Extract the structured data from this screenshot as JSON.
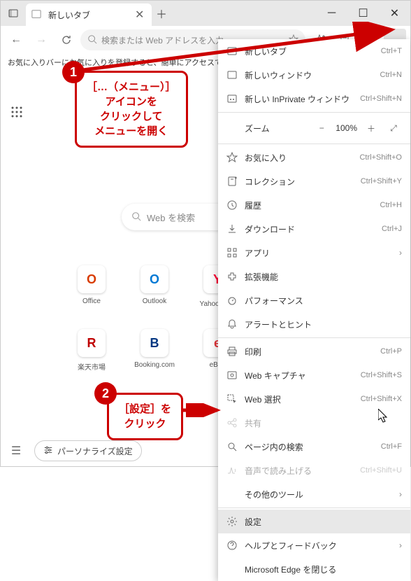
{
  "tab": {
    "title": "新しいタブ"
  },
  "addressbar": {
    "placeholder": "検索または Web アドレスを入力"
  },
  "infobar": {
    "text": "お気に入りバーにお気に入りを登録すると、簡単にアクセスできるようになります。"
  },
  "search": {
    "placeholder": "Web を検索"
  },
  "tiles": [
    {
      "label": "Office",
      "letter": "O",
      "color": "#d83b01"
    },
    {
      "label": "Outlook",
      "letter": "O",
      "color": "#0078d4"
    },
    {
      "label": "Yahoo!メ…",
      "letter": "Y",
      "color": "#ff0033"
    },
    {
      "label": "楽天市場",
      "letter": "R",
      "color": "#bf0000"
    },
    {
      "label": "Booking.com",
      "letter": "B",
      "color": "#003580"
    },
    {
      "label": "eBay",
      "letter": "e",
      "color": "#e53238"
    }
  ],
  "bottom": {
    "personalize": "パーソナライズ設定"
  },
  "menu": {
    "zoom_label": "ズーム",
    "zoom_value": "100%",
    "items": [
      {
        "icon": "tab",
        "label": "新しいタブ",
        "shortcut": "Ctrl+T"
      },
      {
        "icon": "window",
        "label": "新しいウィンドウ",
        "shortcut": "Ctrl+N"
      },
      {
        "icon": "inprivate",
        "label": "新しい InPrivate ウィンドウ",
        "shortcut": "Ctrl+Shift+N"
      },
      {
        "sep": true
      },
      {
        "zoom": true
      },
      {
        "sep": true
      },
      {
        "icon": "star",
        "label": "お気に入り",
        "shortcut": "Ctrl+Shift+O"
      },
      {
        "icon": "collection",
        "label": "コレクション",
        "shortcut": "Ctrl+Shift+Y"
      },
      {
        "icon": "history",
        "label": "履歴",
        "shortcut": "Ctrl+H"
      },
      {
        "icon": "download",
        "label": "ダウンロード",
        "shortcut": "Ctrl+J"
      },
      {
        "icon": "apps",
        "label": "アプリ",
        "arrow": true
      },
      {
        "icon": "ext",
        "label": "拡張機能"
      },
      {
        "icon": "perf",
        "label": "パフォーマンス"
      },
      {
        "icon": "bell",
        "label": "アラートとヒント"
      },
      {
        "sep": true
      },
      {
        "icon": "print",
        "label": "印刷",
        "shortcut": "Ctrl+P"
      },
      {
        "icon": "capture",
        "label": "Web キャプチャ",
        "shortcut": "Ctrl+Shift+S"
      },
      {
        "icon": "select",
        "label": "Web 選択",
        "shortcut": "Ctrl+Shift+X"
      },
      {
        "icon": "share",
        "label": "共有",
        "disabled": true
      },
      {
        "icon": "find",
        "label": "ページ内の検索",
        "shortcut": "Ctrl+F"
      },
      {
        "icon": "read",
        "label": "音声で読み上げる",
        "shortcut": "Ctrl+Shift+U",
        "disabled": true
      },
      {
        "label": "その他のツール",
        "arrow": true,
        "noicon": true
      },
      {
        "sep": true
      },
      {
        "icon": "gear",
        "label": "設定",
        "highlight": true
      },
      {
        "icon": "help",
        "label": "ヘルプとフィードバック",
        "arrow": true
      },
      {
        "label": "Microsoft Edge を閉じる",
        "noicon": true
      }
    ]
  },
  "callouts": {
    "c1": "［…（メニュー）］\nアイコンを\nクリックして\nメニューを開く",
    "c2": "［設定］を\nクリック",
    "b1": "1",
    "b2": "2"
  }
}
